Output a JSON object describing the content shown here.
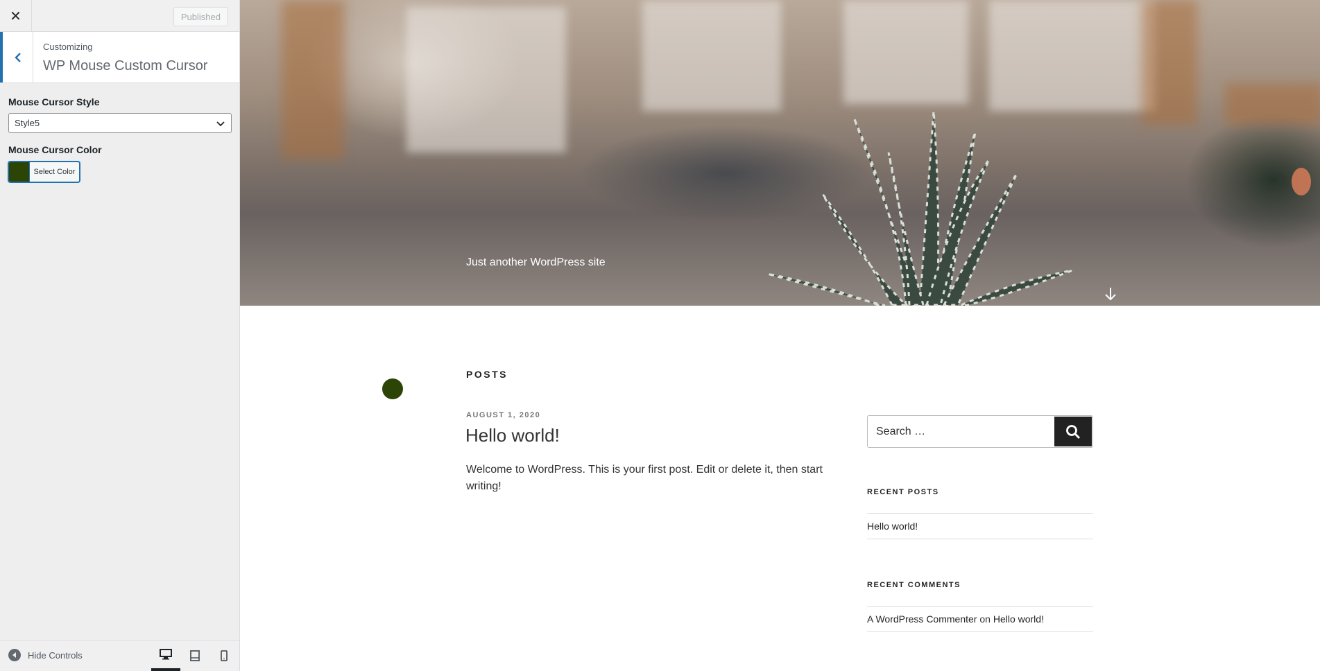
{
  "customizer": {
    "close_icon": "close-icon",
    "publish_label": "Published",
    "section": {
      "subtitle": "Customizing",
      "title": "WP Mouse Custom Cursor"
    },
    "controls": {
      "cursor_style": {
        "label": "Mouse Cursor Style",
        "value": "Style5"
      },
      "cursor_color": {
        "label": "Mouse Cursor Color",
        "button_label": "Select Color",
        "color": "#2c4406"
      }
    },
    "footer": {
      "hide_label": "Hide Controls",
      "devices": [
        "desktop-icon",
        "tablet-icon",
        "mobile-icon"
      ],
      "active_device": "desktop"
    }
  },
  "preview": {
    "tagline": "Just another WordPress site",
    "posts_heading": "POSTS",
    "post": {
      "date": "AUGUST 1, 2020",
      "title": "Hello world!",
      "excerpt": "Welcome to WordPress. This is your first post. Edit or delete it, then start writing!"
    },
    "search": {
      "placeholder": "Search …"
    },
    "recent_posts": {
      "title": "RECENT POSTS",
      "items": [
        "Hello world!"
      ]
    },
    "recent_comments": {
      "title": "RECENT COMMENTS",
      "author": "A WordPress Commenter",
      "connector": "on",
      "post": "Hello world!"
    },
    "cursor_color": "#2c4406"
  }
}
